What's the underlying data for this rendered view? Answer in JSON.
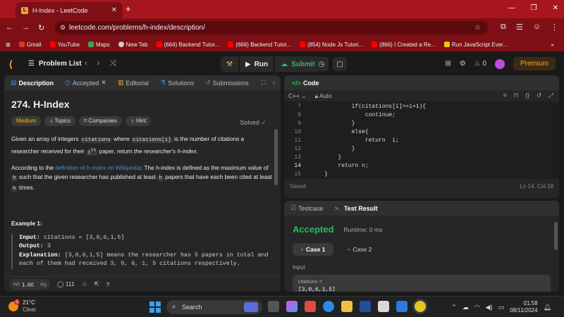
{
  "browser": {
    "tab_title": "H-Index - LeetCode",
    "url": "leetcode.com/problems/h-index/description/",
    "bookmarks": [
      {
        "label": "Gmail",
        "color": "#d33"
      },
      {
        "label": "YouTube",
        "color": "#f00"
      },
      {
        "label": "Maps",
        "color": "#34a853"
      },
      {
        "label": "New Tab",
        "color": "#ccc"
      },
      {
        "label": "(664) Backend Tutor...",
        "color": "#f00"
      },
      {
        "label": "(666) Backend Tutor...",
        "color": "#f00"
      },
      {
        "label": "(854) Node Js Tutori...",
        "color": "#f00"
      },
      {
        "label": "(866) I Created a Re...",
        "color": "#f00"
      },
      {
        "label": "Run JavaScript Ever...",
        "color": "#f0c419"
      }
    ]
  },
  "lc": {
    "problem_list": "Problem List",
    "run": "Run",
    "submit": "Submit",
    "fire_count": "0",
    "premium": "Premium"
  },
  "left_tabs": [
    "Description",
    "Accepted",
    "Editorial",
    "Solutions",
    "Submissions"
  ],
  "problem": {
    "title": "274. H-Index",
    "solved": "Solved",
    "tags": [
      "Medium",
      "Topics",
      "Companies",
      "Hint"
    ],
    "p1_a": "Given an array of integers ",
    "p1_code1": "citations",
    "p1_b": " where ",
    "p1_code2": "citations[i]",
    "p1_c": " is the number of citations a researcher received for their ",
    "p1_code3": "i",
    "p1_sup": "th",
    "p1_d": " paper, return ",
    "p1_em": "the researcher's h-index",
    "p1_e": ".",
    "p2_a": "According to the ",
    "p2_link": "definition of h-index on Wikipedia",
    "p2_b": ": The h-index is defined as the maximum value of ",
    "p2_code1": "h",
    "p2_c": " such that the given researcher has published at least ",
    "p2_code2": "h",
    "p2_d": " papers that have each been cited at least ",
    "p2_code3": "h",
    "p2_e": " times.",
    "example_heading": "Example 1:",
    "input_label": "Input:",
    "input_value": " citations = [3,0,6,1,5]",
    "output_label": "Output:",
    "output_value": " 3",
    "explanation_label": "Explanation:",
    "explanation_value": " [3,0,6,1,5] means the researcher has 5 papers in total and each of them had received 3, 0, 6, 1, 5 citations respectively.",
    "likes": "1.4K",
    "comments": "111"
  },
  "code": {
    "header": "Code",
    "language": "C++",
    "mode": "Auto",
    "lines": [
      {
        "n": "7",
        "t": "            if(citations[i]>=i+1){"
      },
      {
        "n": "8",
        "t": "                continue;"
      },
      {
        "n": "9",
        "t": "            }"
      },
      {
        "n": "10",
        "t": "            else{"
      },
      {
        "n": "11",
        "t": "                return  i;"
      },
      {
        "n": "12",
        "t": "            }"
      },
      {
        "n": "13",
        "t": "        }"
      },
      {
        "n": "14",
        "t": "        return n;"
      },
      {
        "n": "15",
        "t": "    }"
      }
    ],
    "saved": "Saved",
    "position": "Ln 14, Col 18"
  },
  "test": {
    "tab1": "Testcase",
    "tab2": "Test Result",
    "status": "Accepted",
    "runtime": "Runtime: 0 ms",
    "case1": "Case 1",
    "case2": "Case 2",
    "input_label": "Input",
    "input_var": "citations =",
    "input_val": "[3,0,6,1,5]"
  },
  "taskbar": {
    "temp": "21°C",
    "weather": "Clear",
    "search": "Search",
    "time": "01:58",
    "date": "08/11/2024",
    "notif": "1"
  }
}
